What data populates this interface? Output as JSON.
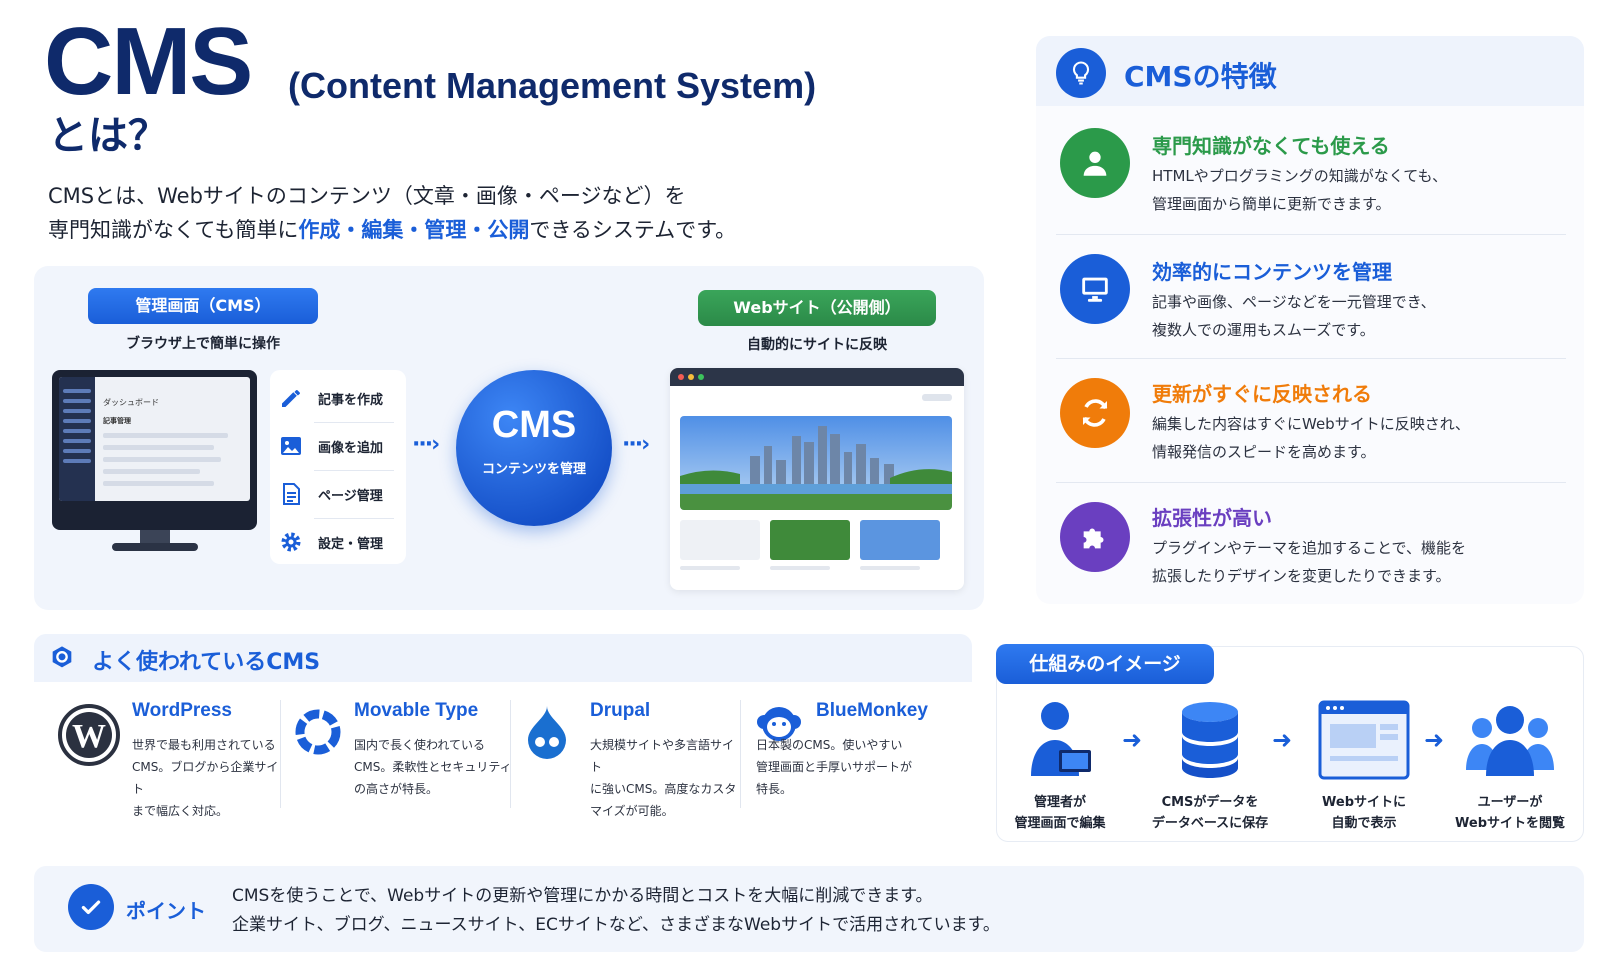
{
  "title": {
    "main": "CMS",
    "sub": "(Content Management System)",
    "toha": "とは？"
  },
  "intro": {
    "line1": "CMSとは、Webサイトのコンテンツ（文章・画像・ページなど）を",
    "line2_prefix": "専門知識がなくても簡単に",
    "line2_h1": "作成",
    "line2_h2": "編集",
    "line2_h3": "管理",
    "line2_h4": "公開",
    "sep": "・",
    "line2_suffix": "できるシステムです。"
  },
  "flow": {
    "admin_pill": "管理画面（CMS）",
    "admin_caption": "ブラウザ上で簡単に操作",
    "monitor_dashboard": "ダッシュボード",
    "monitor_sub": "記事管理",
    "actions": [
      {
        "label": "記事を作成",
        "icon": "pencil-icon"
      },
      {
        "label": "画像を追加",
        "icon": "image-icon"
      },
      {
        "label": "ページ管理",
        "icon": "document-icon"
      },
      {
        "label": "設定・管理",
        "icon": "gear-icon"
      }
    ],
    "arrow": "···›",
    "cms_circle_title": "CMS",
    "cms_circle_sub": "コンテンツを管理",
    "web_pill": "Webサイト（公開側）",
    "web_caption": "自動的にサイトに反映"
  },
  "features": {
    "title": "CMSの特徴",
    "head_icon": "lightbulb-icon",
    "items": [
      {
        "title": "専門知識がなくても使える",
        "desc1": "HTMLやプログラミングの知識がなくても、",
        "desc2": "管理画面から簡単に更新できます。",
        "color": "#2b9a4a",
        "icon": "user-icon"
      },
      {
        "title": "効率的にコンテンツを管理",
        "desc1": "記事や画像、ページなどを一元管理でき、",
        "desc2": "複数人での運用もスムーズです。",
        "color": "#1a5ed8",
        "icon": "monitor-icon"
      },
      {
        "title": "更新がすぐに反映される",
        "desc1": "編集した内容はすぐにWebサイトに反映され、",
        "desc2": "情報発信のスピードを高めます。",
        "color": "#f07c0a",
        "icon": "refresh-icon"
      },
      {
        "title": "拡張性が高い",
        "desc1": "プラグインやテーマを追加することで、機能を",
        "desc2": "拡張したりデザインを変更したりできます。",
        "color": "#6a3fc0",
        "icon": "puzzle-icon"
      }
    ]
  },
  "popular": {
    "title": "よく使われているCMS",
    "items": [
      {
        "name": "WordPress",
        "desc": [
          "世界で最も利用されている",
          "CMS。ブログから企業サイト",
          "まで幅広く対応。"
        ],
        "icon": "wordpress-icon"
      },
      {
        "name": "Movable Type",
        "desc": [
          "国内で長く使われている",
          "CMS。柔軟性とセキュリティ",
          "の高さが特長。"
        ],
        "icon": "movabletype-icon"
      },
      {
        "name": "Drupal",
        "desc": [
          "大規模サイトや多言語サイト",
          "に強いCMS。高度なカスタ",
          "マイズが可能。"
        ],
        "icon": "drupal-icon"
      },
      {
        "name": "BlueMonkey",
        "desc": [
          "日本製のCMS。使いやすい",
          "管理画面と手厚いサポートが",
          "特長。"
        ],
        "icon": "bluemonkey-icon"
      }
    ]
  },
  "mechanism": {
    "title": "仕組みのイメージ",
    "steps": [
      {
        "line1": "管理者が",
        "line2": "管理画面で編集",
        "icon": "admin-laptop-icon"
      },
      {
        "line1": "CMSがデータを",
        "line2": "データベースに保存",
        "icon": "database-icon"
      },
      {
        "line1": "Webサイトに",
        "line2": "自動で表示",
        "icon": "browser-icon"
      },
      {
        "line1": "ユーザーが",
        "line2": "Webサイトを閲覧",
        "icon": "users-icon"
      }
    ],
    "arrow": "➜"
  },
  "point": {
    "label": "ポイント",
    "line1": "CMSを使うことで、Webサイトの更新や管理にかかる時間とコストを大幅に削減できます。",
    "line2": "企業サイト、ブログ、ニュースサイト、ECサイトなど、さまざまなWebサイトで活用されています。"
  },
  "colors": {
    "brand_navy": "#0f2a6b",
    "accent_blue": "#1a5ed8",
    "green": "#2b9a4a",
    "orange": "#f07c0a",
    "purple": "#6a3fc0"
  }
}
